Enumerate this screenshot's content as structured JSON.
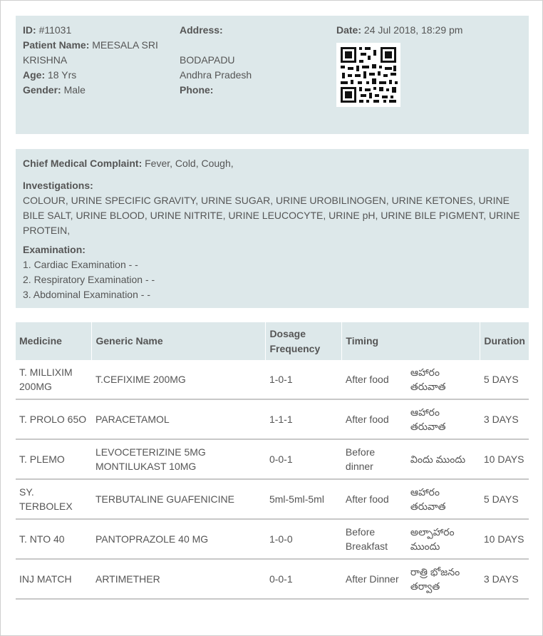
{
  "patient": {
    "id_label": "ID:",
    "id_value": "#11031",
    "name_label": "Patient Name:",
    "name_value": "MEESALA SRI KRISHNA",
    "age_label": "Age:",
    "age_value": "18 Yrs",
    "gender_label": "Gender:",
    "gender_value": "Male",
    "address_label": "Address:",
    "address_line1": "BODAPADU",
    "address_line2": "Andhra Pradesh",
    "phone_label": "Phone:",
    "phone_value": "",
    "date_label": "Date:",
    "date_value": "24 Jul 2018, 18:29 pm"
  },
  "clinical": {
    "complaint_label": "Chief Medical Complaint:",
    "complaint_value": "Fever, Cold, Cough,",
    "investigations_label": "Investigations:",
    "investigations_value": "COLOUR, URINE SPECIFIC GRAVITY, URINE SUGAR, URINE UROBILINOGEN, URINE KETONES, URINE BILE SALT, URINE BLOOD, URINE NITRITE, URINE LEUCOCYTE, URINE pH, URINE BILE PIGMENT, URINE PROTEIN,",
    "examination_label": "Examination:",
    "examinations": [
      "1. Cardiac Examination - -",
      "2. Respiratory Examination - -",
      "3. Abdominal Examination - -"
    ]
  },
  "prescription": {
    "headers": {
      "medicine": "Medicine",
      "generic": "Generic Name",
      "dosage": "Dosage Frequency",
      "timing": "Timing",
      "duration": "Duration"
    },
    "rows": [
      {
        "medicine": "T. MILLIXIM 200MG",
        "generic": "T.CEFIXIME 200MG",
        "dosage": "1-0-1",
        "timing": "After food",
        "timing_local": "ఆహారం తరువాత",
        "duration": "5 DAYS"
      },
      {
        "medicine": "T. PROLO 65O",
        "generic": "PARACETAMOL",
        "dosage": "1-1-1",
        "timing": "After food",
        "timing_local": "ఆహారం తరువాత",
        "duration": "3 DAYS"
      },
      {
        "medicine": "T. PLEMO",
        "generic": "LEVOCETERIZINE 5MG MONTILUKAST 10MG",
        "dosage": "0-0-1",
        "timing": "Before dinner",
        "timing_local": "విందు ముందు",
        "duration": "10 DAYS"
      },
      {
        "medicine": "SY. TERBOLEX",
        "generic": "TERBUTALINE GUAFENICINE",
        "dosage": "5ml-5ml-5ml",
        "timing": "After food",
        "timing_local": "ఆహారం తరువాత",
        "duration": "5 DAYS"
      },
      {
        "medicine": "T. NTO 40",
        "generic": "PANTOPRAZOLE 40 MG",
        "dosage": "1-0-0",
        "timing": "Before Breakfast",
        "timing_local": "అల్పాహారం ముందు",
        "duration": "10 DAYS"
      },
      {
        "medicine": "INJ MATCH",
        "generic": "ARTIMETHER",
        "dosage": "0-0-1",
        "timing": "After Dinner",
        "timing_local": "రాత్రి భోజనం తర్వాత",
        "duration": "3 DAYS"
      }
    ]
  }
}
